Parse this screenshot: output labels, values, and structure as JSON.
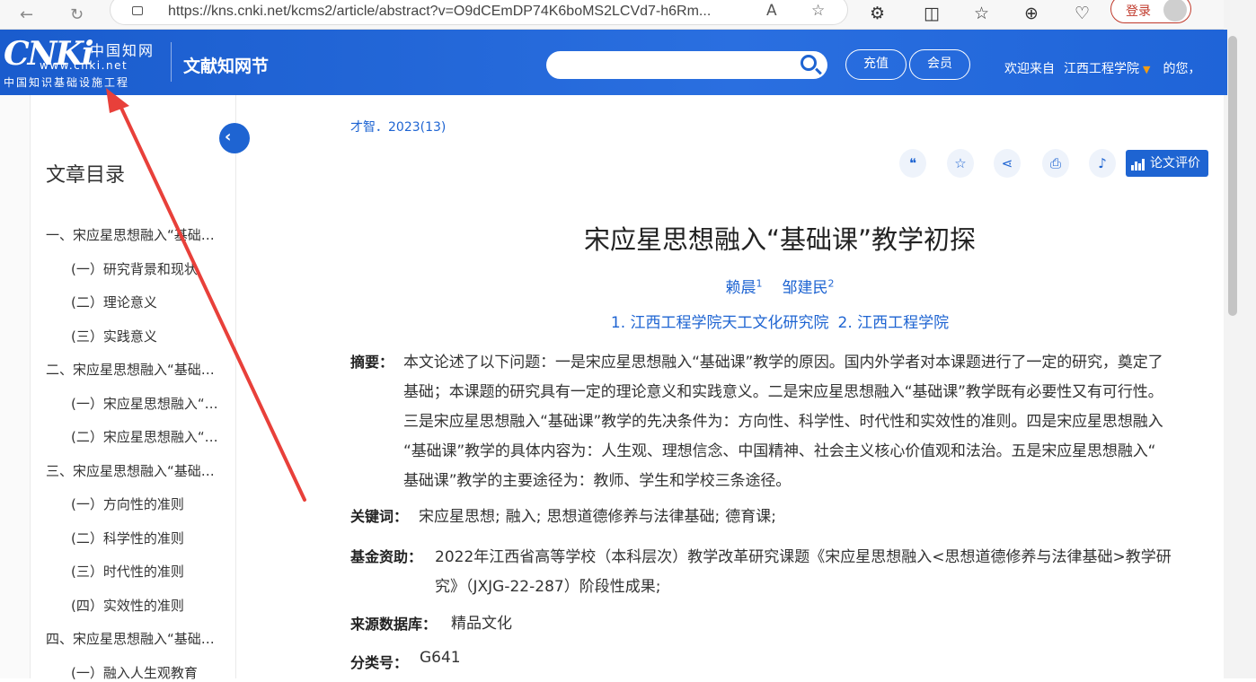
{
  "browser": {
    "url": "https://kns.cnki.net/kcms2/article/abstract?v=O9dCEmDP74K6boMS2LCVd7-h6Rm...",
    "login_label": "登录"
  },
  "header": {
    "logo_main": "CNKi",
    "logo_cn": "中国知网",
    "logo_www": "www.cnki.net",
    "logo_sub": "中国知识基础设施工程",
    "site_name": "文献知网节",
    "search_placeholder": "",
    "recharge": "充值",
    "member": "会员",
    "welcome": "欢迎来自",
    "institution": "江西工程学院",
    "greeting_tail": "的您，"
  },
  "sidebar": {
    "title": "文章目录",
    "items": [
      {
        "text": "一、宋应星思想融入“基础课”教学的原因",
        "level": 1
      },
      {
        "text": "(一）研究背景和现状",
        "level": 2
      },
      {
        "text": "(二）理论意义",
        "level": 2
      },
      {
        "text": "(三）实践意义",
        "level": 2
      },
      {
        "text": "二、宋应星思想融入“基础课”教学的必要性和可行性",
        "level": 1
      },
      {
        "text": "(一）宋应星思想融入“基础课”的必要性",
        "level": 2
      },
      {
        "text": "(二）宋应星思想融入“基础课”的可行性",
        "level": 2
      },
      {
        "text": "三、宋应星思想融入“基础课”教学的先决条件",
        "level": 1
      },
      {
        "text": "(一）方向性的准则",
        "level": 2
      },
      {
        "text": "(二）科学性的准则",
        "level": 2
      },
      {
        "text": "(三）时代性的准则",
        "level": 2
      },
      {
        "text": "(四）实效性的准则",
        "level": 2
      },
      {
        "text": "四、宋应星思想融入“基础课”教学的具体内容",
        "level": 1
      },
      {
        "text": "(一）融入人生观教育",
        "level": 2
      }
    ]
  },
  "article": {
    "journal": "才智．2023(13)",
    "eval_label": "论文评价",
    "title": "宋应星思想融入“基础课”教学初探",
    "author1": "赖晨",
    "author1_sup": "1",
    "author2": "邹建民",
    "author2_sup": "2",
    "affil1": "1. 江西工程学院天工文化研究院",
    "affil2": "2. 江西工程学院",
    "abstract_label": "摘要：",
    "abstract_lines": [
      "本文论述了以下问题：一是宋应星思想融入“基础课”教学的原因。国内外学者对本课题进行了一定的研究，奠定了",
      "基础；本课题的研究具有一定的理论意义和实践意义。二是宋应星思想融入“基础课”教学既有必要性又有可行性。",
      "三是宋应星思想融入“基础课”教学的先决条件为：方向性、科学性、时代性和实效性的准则。四是宋应星思想融入",
      "“基础课”教学的具体内容为：人生观、理想信念、中国精神、社会主义核心价值观和法治。五是宋应星思想融入“",
      "基础课”教学的主要途径为：教师、学生和学校三条途径。"
    ],
    "keywords_label": "关键词：",
    "keywords": [
      "宋应星思想;",
      "融入;",
      "思想道德修养与法律基础;",
      "德育课;"
    ],
    "fund_label": "基金资助：",
    "fund_lines": [
      "2022年江西省高等学校（本科层次）教学改革研究课题《宋应星思想融入<思想道德修养与法律基础>教学研",
      "究》（JXJG-22-287）阶段性成果;"
    ],
    "source_label": "来源数据库：",
    "source": "精品文化",
    "class_label": "分类号：",
    "class_no": "G641"
  },
  "colors": {
    "brand_blue": "#1e64d2",
    "arrow_red": "#e8403a"
  }
}
